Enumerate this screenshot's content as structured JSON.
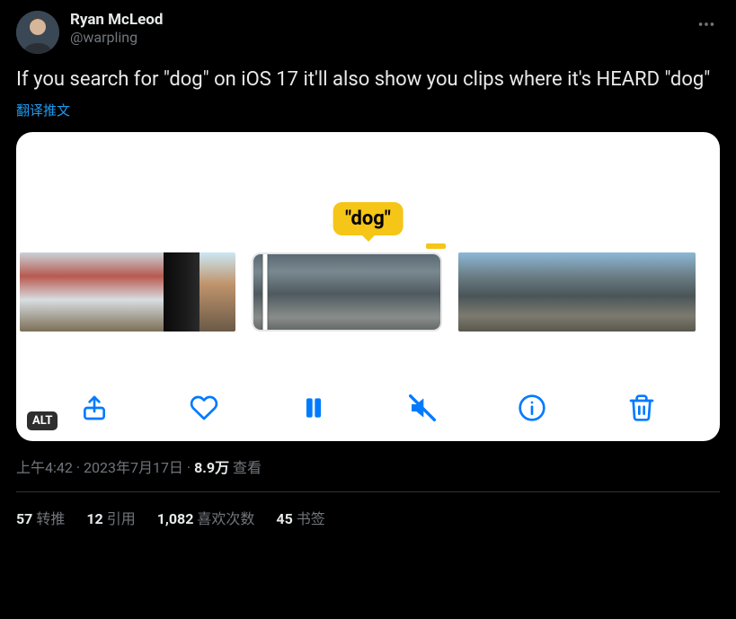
{
  "author": {
    "display_name": "Ryan McLeod",
    "handle": "@warpling"
  },
  "tweet_text": "If you search for \"dog\" on iOS 17 it'll also show you clips where it's HEARD \"dog\"",
  "translate_label": "翻译推文",
  "media": {
    "tooltip": "\"dog\"",
    "alt_badge": "ALT"
  },
  "meta": {
    "time": "上午4:42",
    "date": "2023年7月17日",
    "views_number": "8.9万",
    "views_suffix": " 查看",
    "separator": " · "
  },
  "stats": {
    "retweets_n": "57",
    "retweets_label": "转推",
    "quotes_n": "12",
    "quotes_label": "引用",
    "likes_n": "1,082",
    "likes_label": "喜欢次数",
    "bookmarks_n": "45",
    "bookmarks_label": "书签"
  }
}
